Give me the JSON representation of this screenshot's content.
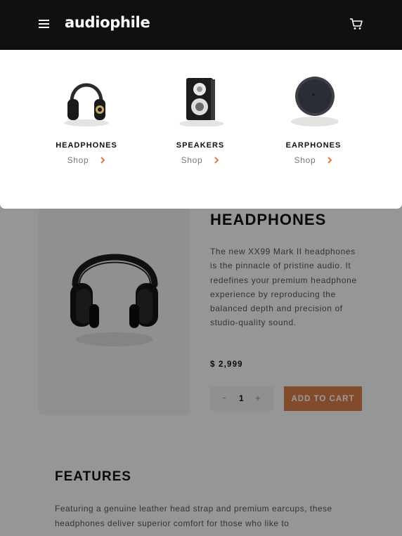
{
  "header": {
    "logo": "audiophile",
    "menu_icon": "hamburger-icon",
    "cart_icon": "cart-icon",
    "background": "#101010"
  },
  "menu": {
    "categories": [
      {
        "name": "HEADPHONES",
        "shop": "Shop",
        "icon": "headphones-image"
      },
      {
        "name": "SPEAKERS",
        "shop": "Shop",
        "icon": "speaker-image"
      },
      {
        "name": "EARPHONES",
        "shop": "Shop",
        "icon": "earphones-image"
      }
    ],
    "chevron_icon": "chevron-right-icon"
  },
  "product": {
    "title": "HEADPHONES",
    "description": "The new XX99 Mark II headphones is the pinnacle of pristine audio. It redefines your premium headphone experience by reproducing the balanced depth and precision of studio-quality sound.",
    "price": "$ 2,999",
    "quantity": {
      "minus": "-",
      "value": "1",
      "plus": "+"
    },
    "add_to_cart": "ADD TO CART"
  },
  "features": {
    "title": "FEATURES",
    "text": "Featuring a genuine leather head strap and premium earcups, these headphones deliver superior comfort for those who like to"
  },
  "colors": {
    "accent": "#d87d4a",
    "dark": "#101010",
    "panel": "#f1f1f1"
  }
}
